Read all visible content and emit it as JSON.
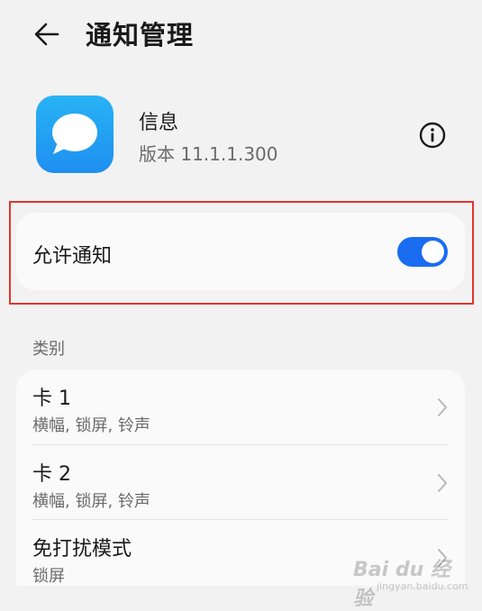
{
  "header": {
    "back_icon": "arrow-left-icon",
    "title": "通知管理"
  },
  "app": {
    "icon": "message-bubble-icon",
    "icon_color": "#1f8ff0",
    "name": "信息",
    "version": "版本 11.1.1.300",
    "info_icon": "info-circle-icon"
  },
  "allow_notifications": {
    "label": "允许通知",
    "enabled": true,
    "toggle_color": "#1a6cf1"
  },
  "highlight_color": "#e0362d",
  "categories": {
    "label": "类别",
    "items": [
      {
        "title": "卡 1",
        "subtitle": "横幅, 锁屏, 铃声"
      },
      {
        "title": "卡 2",
        "subtitle": "横幅, 锁屏, 铃声"
      },
      {
        "title": "免打扰模式",
        "subtitle": "锁屏"
      }
    ]
  },
  "watermark": {
    "line1": "Bai du 经验",
    "line2": "jingyan.baidu.com"
  }
}
